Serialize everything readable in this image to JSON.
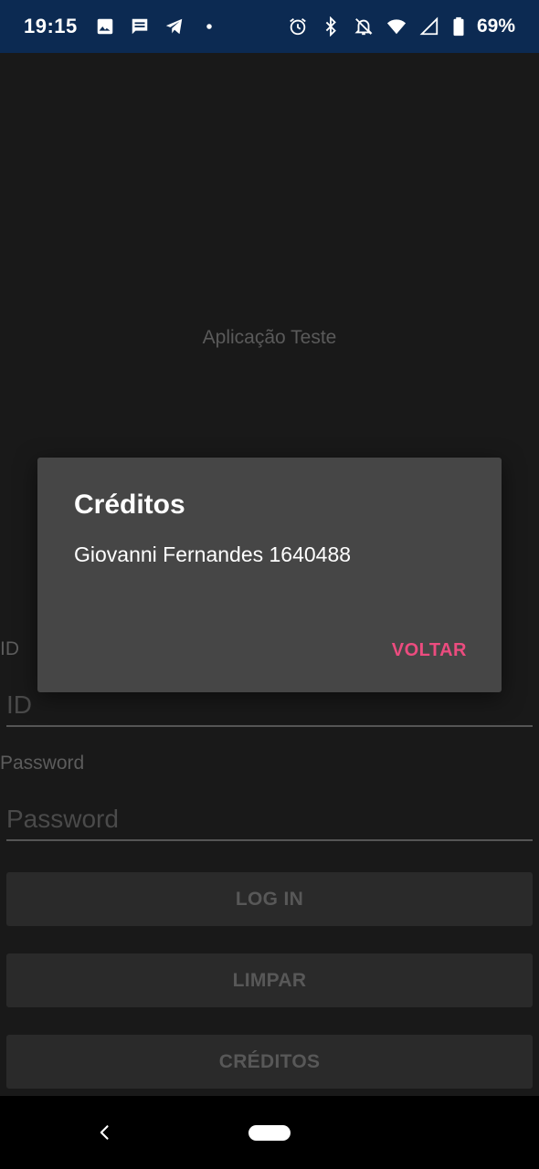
{
  "status_bar": {
    "time": "19:15",
    "left_icons": [
      "image-icon",
      "message-icon",
      "telegram-icon",
      "dot-icon"
    ],
    "right_icons": [
      "alarm-icon",
      "bluetooth-icon",
      "bell-off-icon",
      "wifi-icon",
      "signal-icon",
      "battery-icon"
    ],
    "battery": "69%"
  },
  "app": {
    "title": "Aplicação Teste",
    "id_label": "ID",
    "id_placeholder": "ID",
    "password_label": "Password",
    "password_placeholder": "Password",
    "login_button": "LOG IN",
    "clear_button": "LIMPAR",
    "credits_button": "CRÉDITOS"
  },
  "dialog": {
    "title": "Créditos",
    "message": "Giovanni Fernandes 1640488",
    "button": "VOLTAR",
    "accent_color": "#ec4c7f"
  },
  "colors": {
    "status_bar": "#0c2a52",
    "background": "#191919",
    "dialog": "#464646"
  }
}
